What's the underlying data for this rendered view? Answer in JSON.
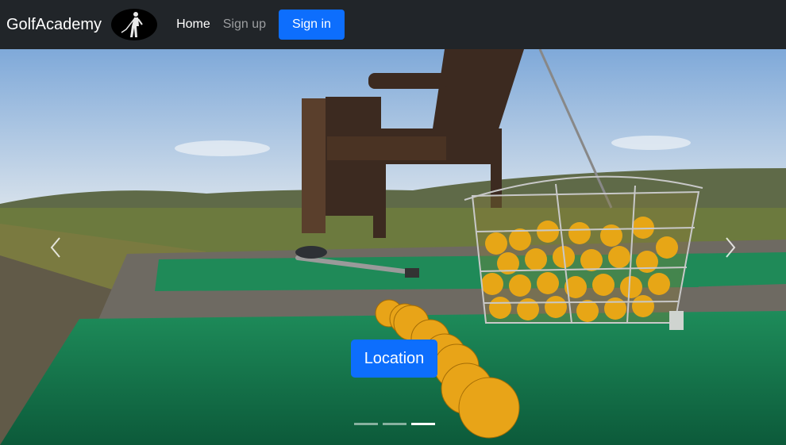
{
  "navbar": {
    "brand": "GolfAcademy",
    "links": [
      {
        "label": "Home",
        "active": true
      },
      {
        "label": "Sign up",
        "active": false
      }
    ],
    "signin_label": "Sign in"
  },
  "carousel": {
    "caption_button_label": "Location",
    "slide_count": 3,
    "active_slide": 3
  },
  "colors": {
    "navbar_bg": "#212529",
    "primary": "#0d6efd"
  }
}
